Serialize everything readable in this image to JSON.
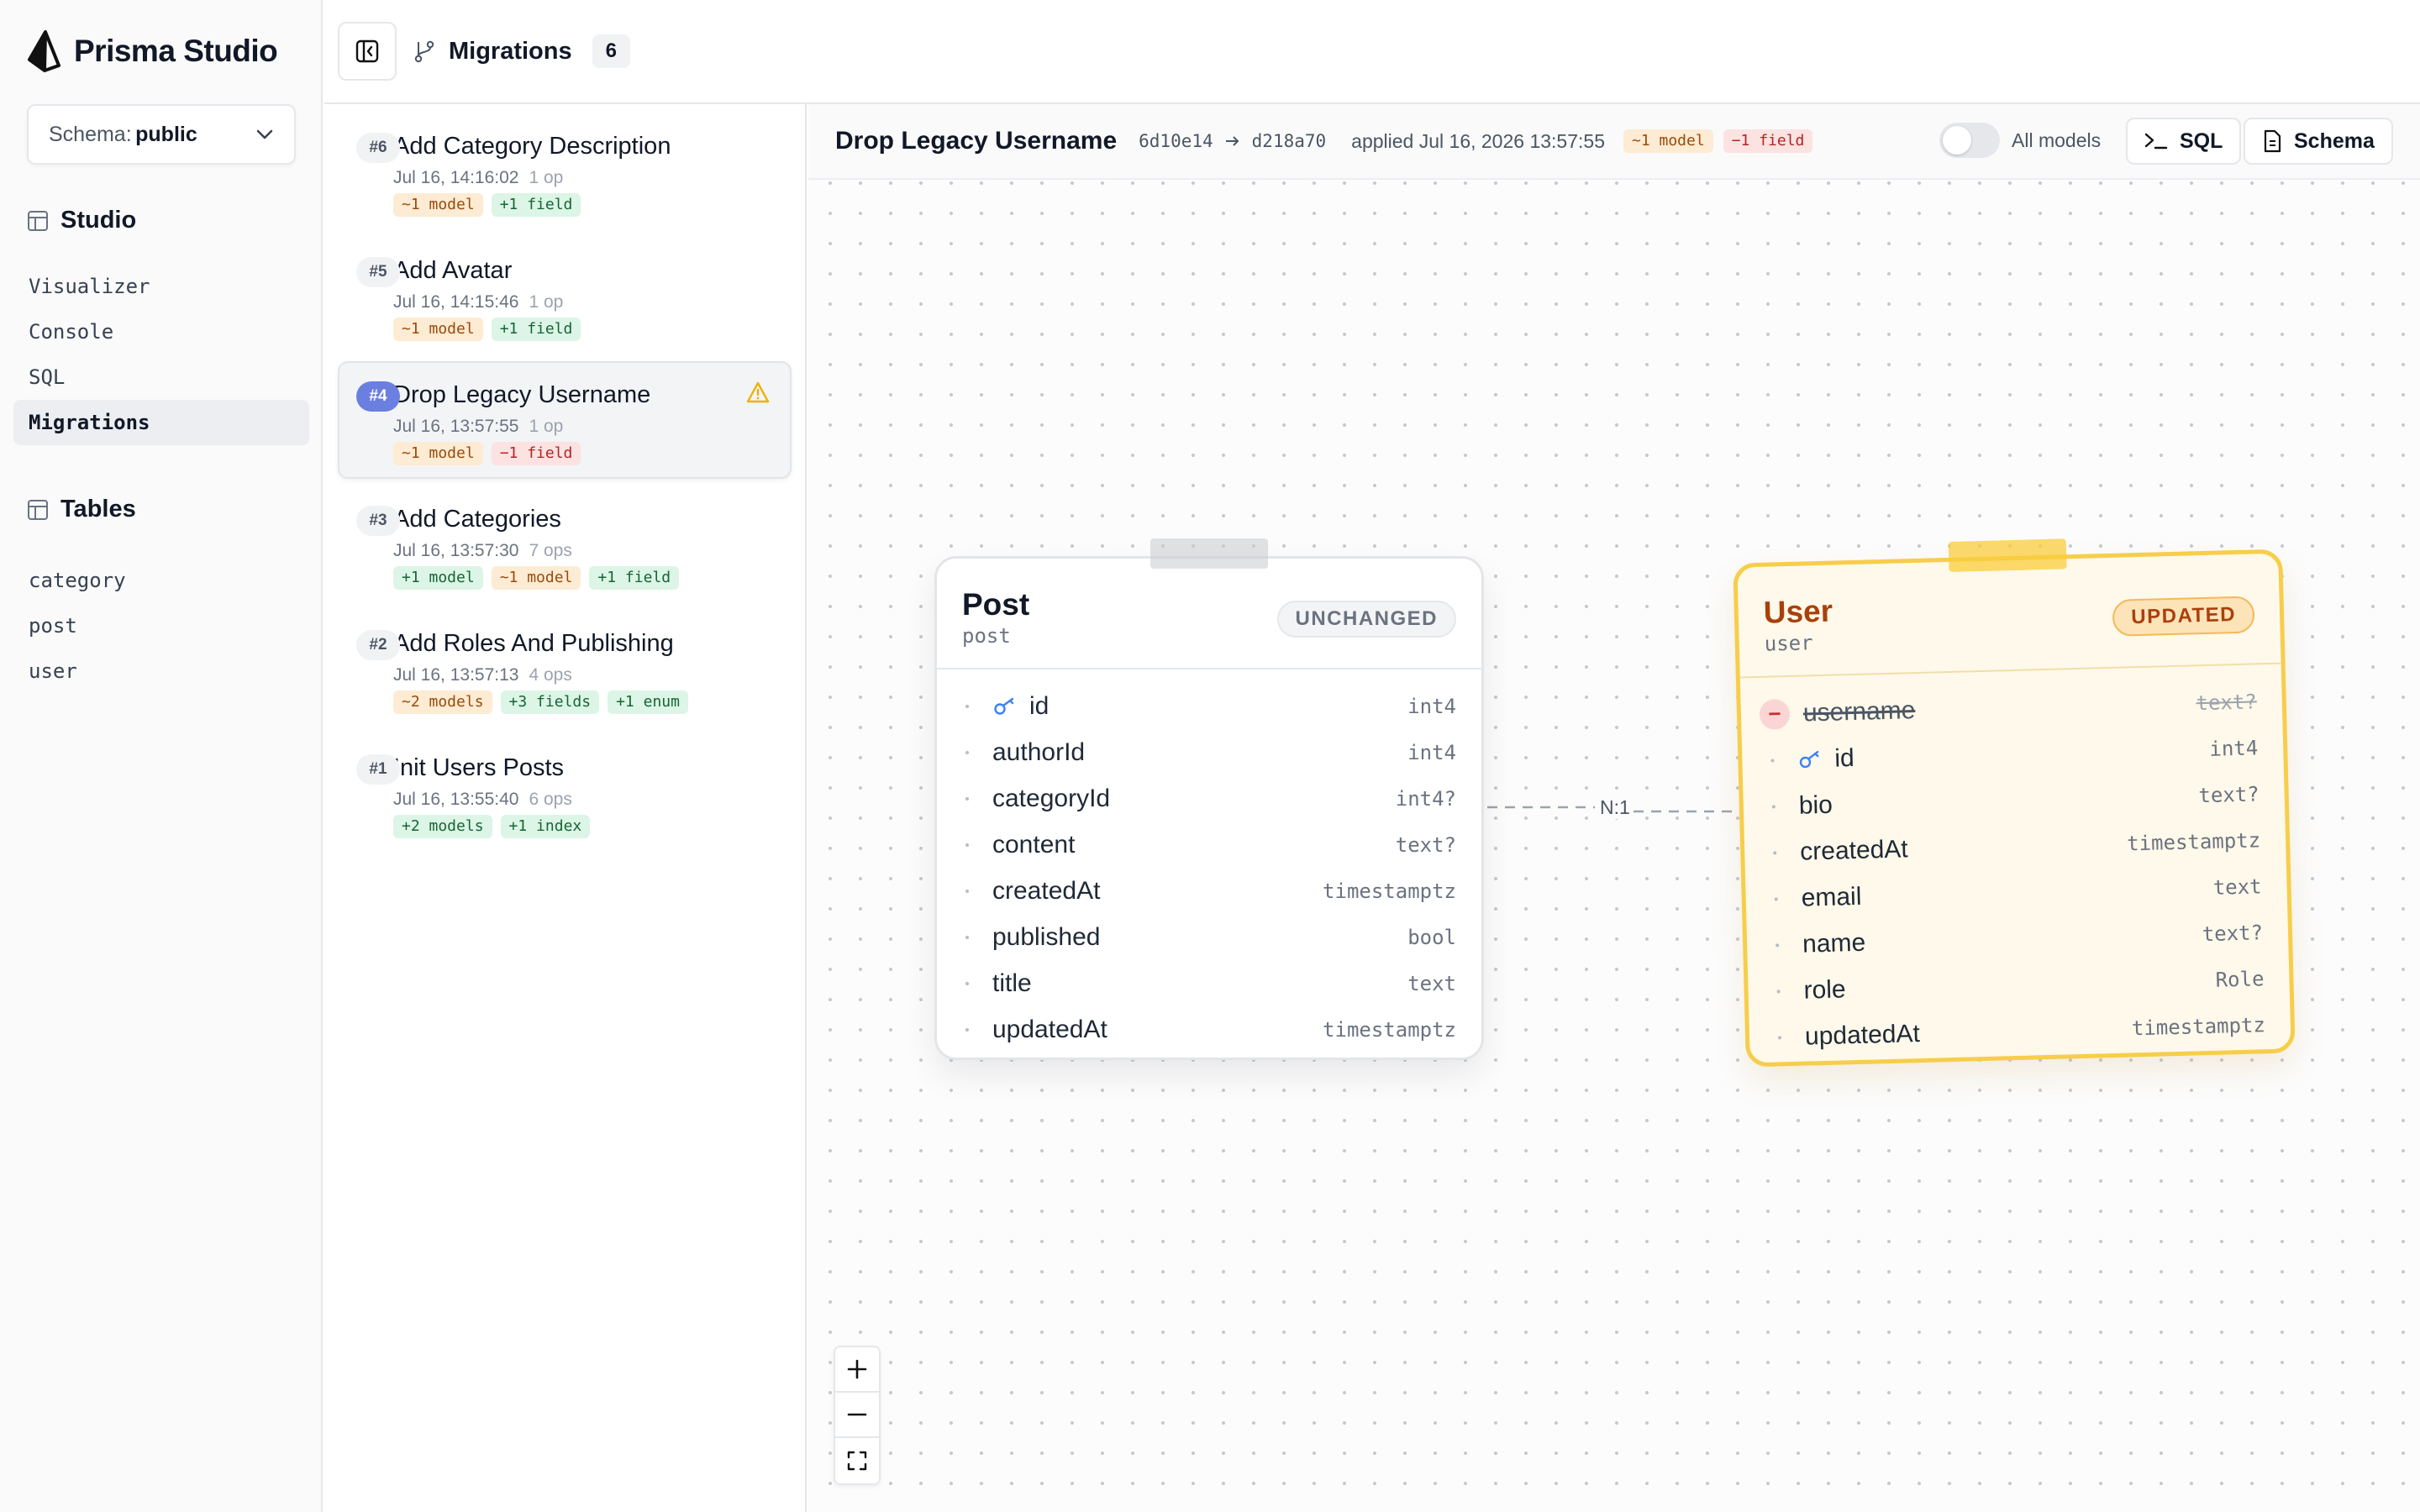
{
  "app": {
    "name": "Prisma Studio"
  },
  "schema_select": {
    "label": "Schema:",
    "value": "public"
  },
  "studio": {
    "heading": "Studio",
    "items": [
      {
        "label": "Visualizer",
        "active": false
      },
      {
        "label": "Console",
        "active": false
      },
      {
        "label": "SQL",
        "active": false
      },
      {
        "label": "Migrations",
        "active": true
      }
    ]
  },
  "tables_nav": {
    "heading": "Tables",
    "items": [
      {
        "label": "category"
      },
      {
        "label": "post"
      },
      {
        "label": "user"
      }
    ]
  },
  "topbar": {
    "title": "Migrations",
    "count": "6"
  },
  "migrations": [
    {
      "num": "#6",
      "title": "Add Category Description",
      "date": "Jul 16, 14:16:02",
      "ops": "1 op",
      "selected": false,
      "tags": [
        {
          "text": "~1 model",
          "color": "orange"
        },
        {
          "text": "+1 field",
          "color": "green"
        }
      ]
    },
    {
      "num": "#5",
      "title": "Add Avatar",
      "date": "Jul 16, 14:15:46",
      "ops": "1 op",
      "selected": false,
      "tags": [
        {
          "text": "~1 model",
          "color": "orange"
        },
        {
          "text": "+1 field",
          "color": "green"
        }
      ]
    },
    {
      "num": "#4",
      "title": "Drop Legacy Username",
      "date": "Jul 16, 13:57:55",
      "ops": "1 op",
      "selected": true,
      "warning": true,
      "tags": [
        {
          "text": "~1 model",
          "color": "orange"
        },
        {
          "text": "−1 field",
          "color": "red"
        }
      ]
    },
    {
      "num": "#3",
      "title": "Add Categories",
      "date": "Jul 16, 13:57:30",
      "ops": "7 ops",
      "selected": false,
      "tags": [
        {
          "text": "+1 model",
          "color": "green"
        },
        {
          "text": "~1 model",
          "color": "orange"
        },
        {
          "text": "+1 field",
          "color": "green"
        }
      ]
    },
    {
      "num": "#2",
      "title": "Add Roles And Publishing",
      "date": "Jul 16, 13:57:13",
      "ops": "4 ops",
      "selected": false,
      "tags": [
        {
          "text": "~2 models",
          "color": "orange"
        },
        {
          "text": "+3 fields",
          "color": "green"
        },
        {
          "text": "+1 enum",
          "color": "green"
        }
      ]
    },
    {
      "num": "#1",
      "title": "Init Users Posts",
      "date": "Jul 16, 13:55:40",
      "ops": "6 ops",
      "selected": false,
      "tags": [
        {
          "text": "+2 models",
          "color": "green"
        },
        {
          "text": "+1 index",
          "color": "green"
        }
      ]
    }
  ],
  "detail": {
    "title": "Drop Legacy Username",
    "from_hash": "6d10e14",
    "to_hash": "d218a70",
    "applied": "applied Jul 16, 2026 13:57:55",
    "tags": [
      {
        "text": "~1 model",
        "color": "orange"
      },
      {
        "text": "−1 field",
        "color": "red"
      }
    ],
    "toggle_label": "All models",
    "toggle_on": false,
    "sql_label": "SQL",
    "schema_label": "Schema"
  },
  "post_table": {
    "name": "Post",
    "db_name": "post",
    "status": "UNCHANGED",
    "fields": [
      {
        "name": "id",
        "type": "int4",
        "key": true
      },
      {
        "name": "authorId",
        "type": "int4"
      },
      {
        "name": "categoryId",
        "type": "int4?"
      },
      {
        "name": "content",
        "type": "text?"
      },
      {
        "name": "createdAt",
        "type": "timestamptz"
      },
      {
        "name": "published",
        "type": "bool"
      },
      {
        "name": "title",
        "type": "text"
      },
      {
        "name": "updatedAt",
        "type": "timestamptz"
      }
    ]
  },
  "user_table": {
    "name": "User",
    "db_name": "user",
    "status": "UPDATED",
    "fields": [
      {
        "name": "username",
        "type": "text?",
        "removed": true
      },
      {
        "name": "id",
        "type": "int4",
        "key": true
      },
      {
        "name": "bio",
        "type": "text?"
      },
      {
        "name": "createdAt",
        "type": "timestamptz"
      },
      {
        "name": "email",
        "type": "text"
      },
      {
        "name": "name",
        "type": "text?"
      },
      {
        "name": "role",
        "type": "Role"
      },
      {
        "name": "updatedAt",
        "type": "timestamptz"
      }
    ]
  },
  "relation": {
    "label": "N:1"
  },
  "colors": {
    "accent": "#6b7fe0",
    "updated_border": "#f7cd4a",
    "updated_bg": "#fef9ea",
    "warning": "#eab308"
  }
}
